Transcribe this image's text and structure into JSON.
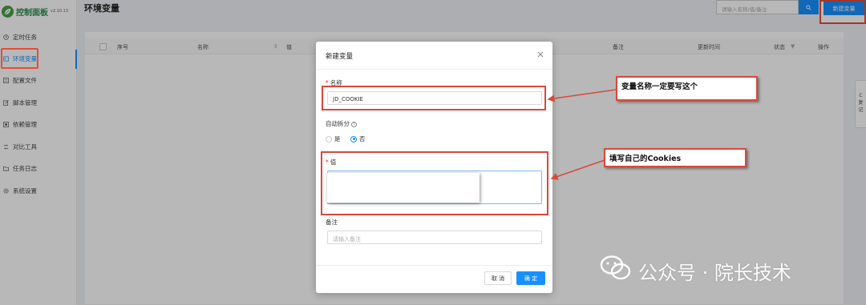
{
  "sidebar": {
    "logo_text": "控制面板",
    "version": "v2.10.13",
    "items": [
      {
        "label": "定时任务",
        "icon": "clock-icon"
      },
      {
        "label": "环境变量",
        "icon": "variable-icon",
        "active": true
      },
      {
        "label": "配置文件",
        "icon": "file-icon"
      },
      {
        "label": "脚本管理",
        "icon": "edit-icon"
      },
      {
        "label": "依赖管理",
        "icon": "package-icon"
      },
      {
        "label": "对比工具",
        "icon": "diff-icon"
      },
      {
        "label": "任务日志",
        "icon": "folder-icon"
      },
      {
        "label": "系统设置",
        "icon": "gear-icon"
      }
    ]
  },
  "header": {
    "title": "环境变量",
    "search_placeholder": "请输入名称/值/备注",
    "new_button": "新建变量"
  },
  "table": {
    "columns": [
      "序号",
      "名称",
      "值",
      "备注",
      "更新时间",
      "状态",
      "操作"
    ]
  },
  "side_widget": [
    "C",
    "复",
    "记"
  ],
  "modal": {
    "title": "新建变量",
    "name_label": "名称",
    "name_value": "JD_COOKIE",
    "split_label": "自动拆分",
    "radio_yes": "是",
    "radio_no": "否",
    "value_label": "值",
    "remark_label": "备注",
    "remark_placeholder": "请输入备注",
    "cancel": "取 消",
    "ok": "确 定"
  },
  "annotations": {
    "callout_name": "变量名称一定要写这个",
    "callout_value": "填写自己的Cookies"
  },
  "watermark": {
    "text": "公众号 · 院长技术"
  },
  "colors": {
    "primary": "#1890ff",
    "annotation_red": "#d9483b",
    "logo_green": "#2e8b57"
  }
}
